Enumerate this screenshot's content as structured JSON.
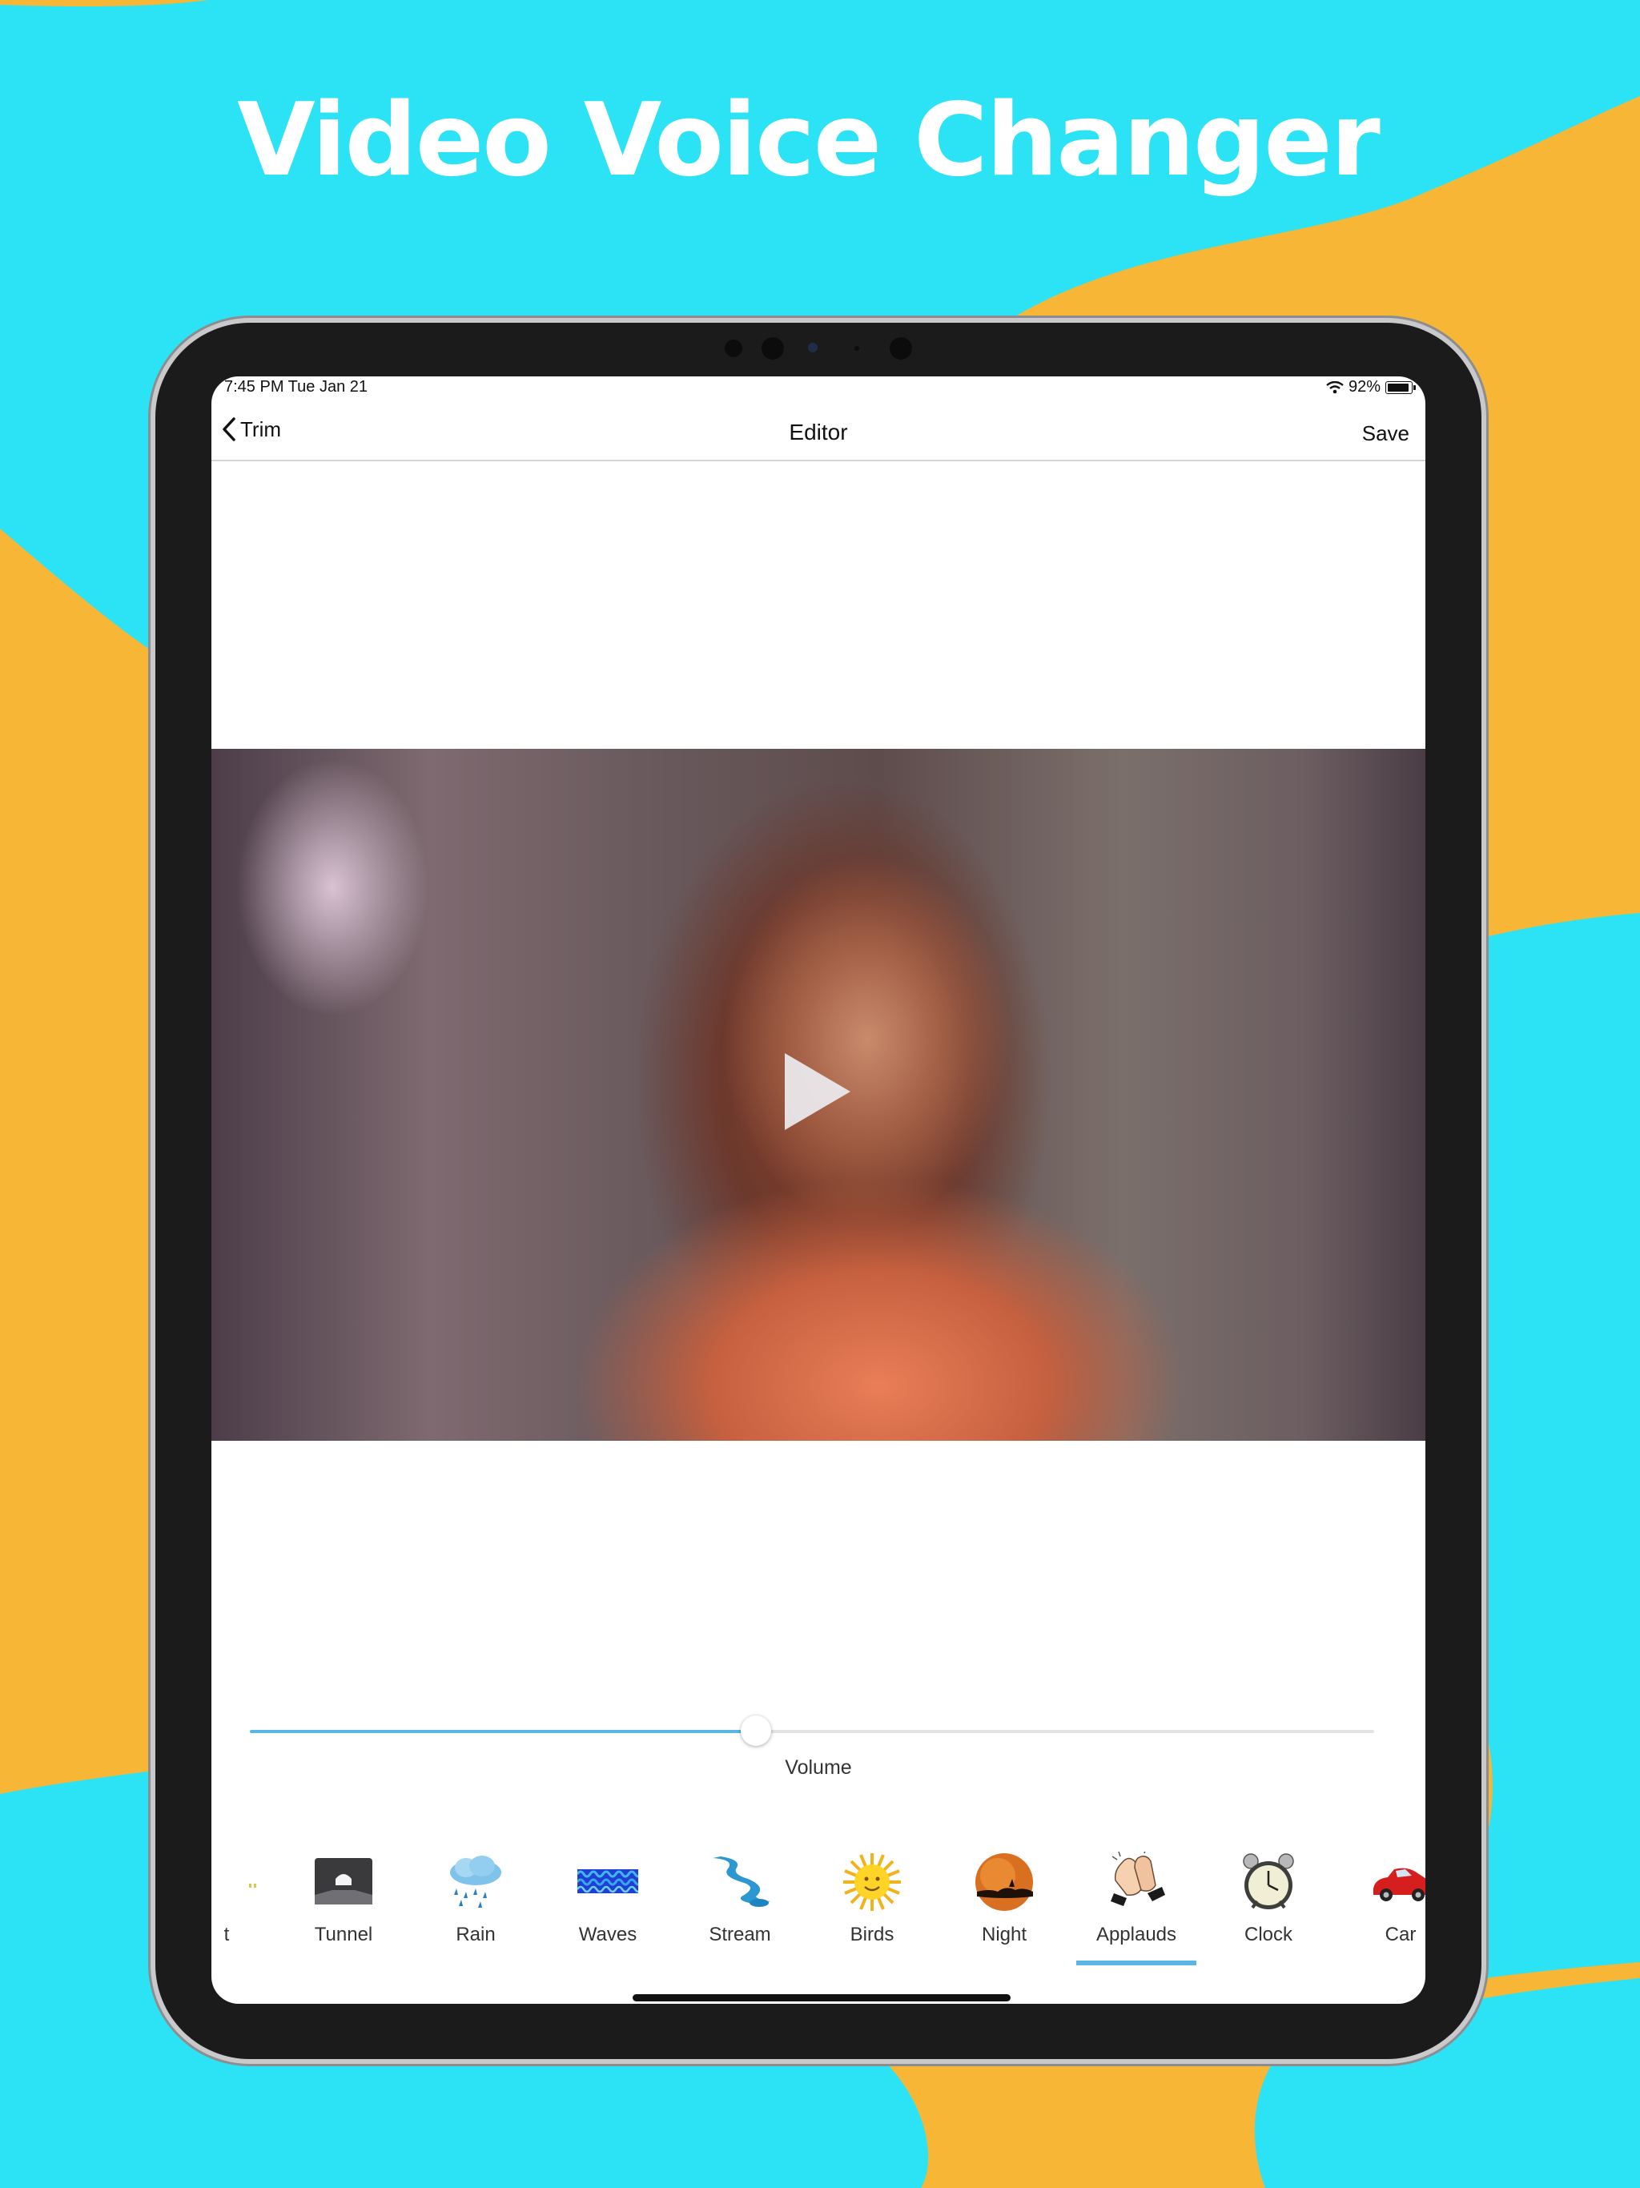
{
  "promo": {
    "headline": "Video Voice Changer"
  },
  "colors": {
    "background": "#2ce3f5",
    "blob": "#f7b636",
    "accent": "#5ab6e3"
  },
  "status_bar": {
    "time": "7:45 PM   Tue Jan 21",
    "battery": "92%",
    "battery_level": 0.92,
    "wifi_icon": "wifi-icon"
  },
  "nav": {
    "back_label": "Trim",
    "back_icon": "chevron-left-icon",
    "title": "Editor",
    "save_label": "Save"
  },
  "player": {
    "play_icon": "play-icon"
  },
  "volume": {
    "label": "Volume",
    "value": 0.45
  },
  "effects": {
    "selected": "Applauds",
    "items": [
      {
        "label": "t",
        "icon": "partial-icon"
      },
      {
        "label": "Tunnel",
        "icon": "tunnel-icon"
      },
      {
        "label": "Rain",
        "icon": "rain-cloud-icon"
      },
      {
        "label": "Waves",
        "icon": "waves-icon"
      },
      {
        "label": "Stream",
        "icon": "stream-icon"
      },
      {
        "label": "Birds",
        "icon": "sun-icon"
      },
      {
        "label": "Night",
        "icon": "night-moon-icon"
      },
      {
        "label": "Applauds",
        "icon": "clapping-hands-icon"
      },
      {
        "label": "Clock",
        "icon": "alarm-clock-icon"
      },
      {
        "label": "Car",
        "icon": "red-car-icon"
      }
    ]
  }
}
